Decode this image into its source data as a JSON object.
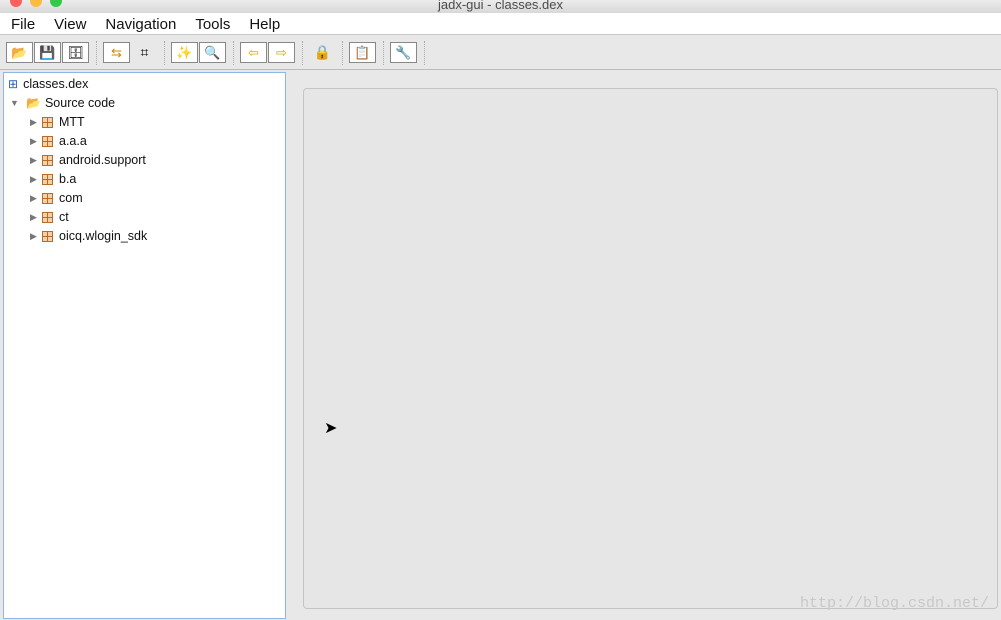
{
  "window": {
    "title": "jadx-gui - classes.dex"
  },
  "menu": [
    "File",
    "View",
    "Navigation",
    "Tools",
    "Help"
  ],
  "toolbar": [
    {
      "icon": "open-file-icon",
      "glyph": "📂"
    },
    {
      "icon": "save-all-icon",
      "glyph": "💾"
    },
    {
      "icon": "export-icon",
      "glyph": "🗄"
    },
    {
      "icon": "sync-icon",
      "glyph": "⇆"
    },
    {
      "icon": "flatten-packages-icon",
      "glyph": "⌗"
    },
    {
      "icon": "text-search-icon",
      "glyph": "✨"
    },
    {
      "icon": "class-search-icon",
      "glyph": "🔍"
    },
    {
      "icon": "back-icon",
      "glyph": "⇦"
    },
    {
      "icon": "forward-icon",
      "glyph": "⇨"
    },
    {
      "icon": "deobfuscation-icon",
      "glyph": "🔒"
    },
    {
      "icon": "log-icon",
      "glyph": "📋"
    },
    {
      "icon": "preferences-icon",
      "glyph": "🔧"
    }
  ],
  "tree": {
    "root": "classes.dex",
    "source": "Source code",
    "packages": [
      "MTT",
      "a.a.a",
      "android.support",
      "b.a",
      "com",
      "ct",
      "oicq.wlogin_sdk"
    ]
  },
  "watermark": "http://blog.csdn.net/"
}
